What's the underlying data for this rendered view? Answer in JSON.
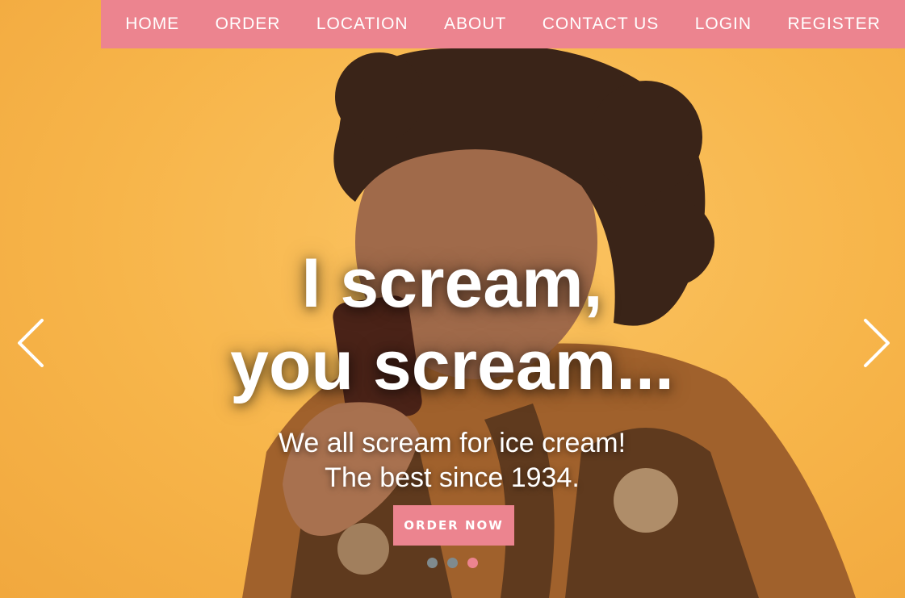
{
  "nav": {
    "items": [
      {
        "label": "HOME"
      },
      {
        "label": "ORDER"
      },
      {
        "label": "LOCATION"
      },
      {
        "label": "ABOUT"
      },
      {
        "label": "CONTACT US"
      },
      {
        "label": "LOGIN"
      },
      {
        "label": "REGISTER"
      }
    ]
  },
  "hero": {
    "headline_line1": "I scream,",
    "headline_line2": "you scream...",
    "sub_line1": "We all scream for ice cream!",
    "sub_line2": "The best since 1934.",
    "cta_label": "ORDER NOW",
    "active_slide": 3,
    "slide_count": 3
  },
  "icons": {
    "prev": "chevron-left-icon",
    "next": "chevron-right-icon"
  },
  "colors": {
    "accent": "#ec848f",
    "background": "#f7b54a",
    "indicator_inactive": "#7f8a8e"
  }
}
